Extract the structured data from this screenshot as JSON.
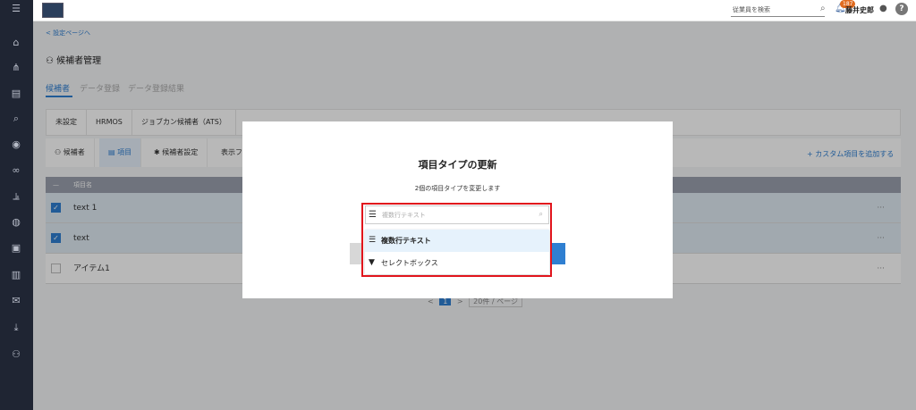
{
  "topbar": {
    "search_placeholder": "従業員を検索",
    "notification_count": "187",
    "user_name": "藤井史郎",
    "help_label": "?"
  },
  "page": {
    "back_link": "< 設定ページへ",
    "title": "候補者管理",
    "main_tabs": [
      "候補者",
      "データ登録",
      "データ登録結果"
    ],
    "source_tabs": [
      "未設定",
      "HRMOS",
      "ジョブカン候補者（ATS）"
    ],
    "sub_tabs": [
      "候補者",
      "項目",
      "候補者設定",
      "表示フ"
    ],
    "add_custom_label": "+ カスタム項目を追加する",
    "table": {
      "header": "項目名",
      "rows": [
        {
          "label": "text 1",
          "selected": true
        },
        {
          "label": "text",
          "selected": true
        },
        {
          "label": "アイテム1",
          "selected": false
        }
      ],
      "more": "···"
    },
    "pagination": {
      "page": "1",
      "page_size": "20件 / ページ"
    }
  },
  "modal": {
    "title": "項目タイプの更新",
    "description": "2個の項目タイプを変更します",
    "select_placeholder": "複数行テキスト",
    "options": [
      {
        "label": "複数行テキスト",
        "icon": "multiline-text-icon"
      },
      {
        "label": "セレクトボックス",
        "icon": "triangle-down-icon"
      }
    ]
  },
  "colors": {
    "accent": "#2f7fd1",
    "sidebar": "#1f2533",
    "highlight": "#e1141c"
  }
}
